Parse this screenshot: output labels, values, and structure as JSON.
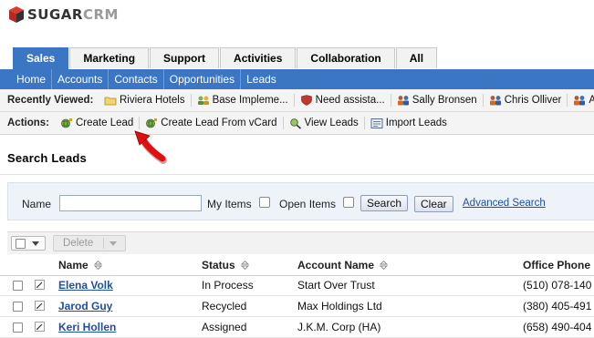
{
  "logo": {
    "part1": "SUGAR",
    "part2": "CRM"
  },
  "tabs": [
    {
      "label": "Sales",
      "active": true
    },
    {
      "label": "Marketing",
      "active": false
    },
    {
      "label": "Support",
      "active": false
    },
    {
      "label": "Activities",
      "active": false
    },
    {
      "label": "Collaboration",
      "active": false
    },
    {
      "label": "All",
      "active": false
    }
  ],
  "subnav": [
    "Home",
    "Accounts",
    "Contacts",
    "Opportunities",
    "Leads"
  ],
  "recent": {
    "label": "Recently Viewed:",
    "items": [
      {
        "label": "Riviera Hotels",
        "icon": "folder-icon"
      },
      {
        "label": "Base Impleme...",
        "icon": "group-icon"
      },
      {
        "label": "Need assista...",
        "icon": "shield-icon"
      },
      {
        "label": "Sally Bronsen",
        "icon": "contacts-icon"
      },
      {
        "label": "Chris Olliver",
        "icon": "contacts-icon"
      },
      {
        "label": "A",
        "icon": "contacts-icon"
      }
    ]
  },
  "actions": {
    "label": "Actions:",
    "items": [
      {
        "label": "Create Lead",
        "icon": "create-lead-icon"
      },
      {
        "label": "Create Lead From vCard",
        "icon": "create-vcard-icon"
      },
      {
        "label": "View Leads",
        "icon": "view-leads-icon"
      },
      {
        "label": "Import Leads",
        "icon": "import-icon"
      }
    ]
  },
  "page_title": "Search Leads",
  "search": {
    "name_label": "Name",
    "name_value": "",
    "my_items_label": "My Items",
    "open_items_label": "Open Items",
    "search_button": "Search",
    "clear_button": "Clear",
    "advanced_link": "Advanced Search"
  },
  "list": {
    "delete_button": "Delete",
    "columns": [
      "Name",
      "Status",
      "Account Name",
      "Office Phone"
    ],
    "rows": [
      {
        "name": "Elena Volk",
        "status": "In Process",
        "account": "Start Over Trust",
        "phone": "(510) 078-140"
      },
      {
        "name": "Jarod Guy",
        "status": "Recycled",
        "account": "Max Holdings Ltd",
        "phone": "(380) 405-491"
      },
      {
        "name": "Keri Hollen",
        "status": "Assigned",
        "account": "J.K.M. Corp (HA)",
        "phone": "(658) 490-404"
      }
    ]
  },
  "colors": {
    "brand_blue": "#3a76c3",
    "link_blue": "#1f4fa3",
    "arrow_red": "#e01010"
  }
}
